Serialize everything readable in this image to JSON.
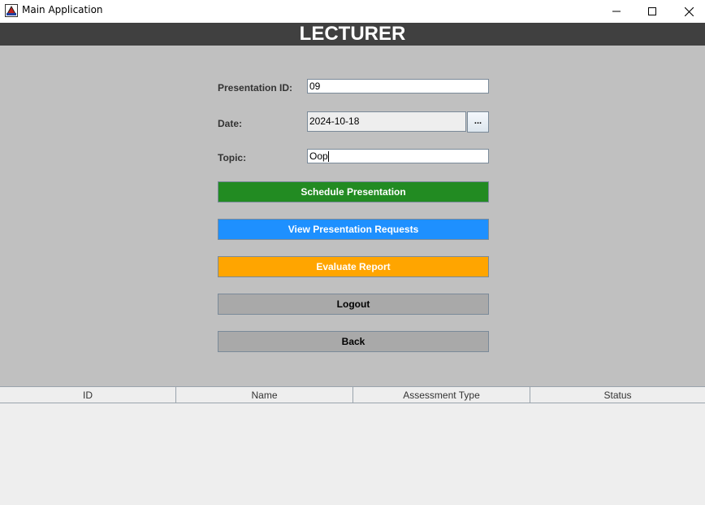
{
  "window": {
    "title": "Main Application",
    "controls": [
      "minimize-icon",
      "maximize-icon",
      "close-icon"
    ]
  },
  "header": {
    "title": "LECTURER",
    "background": "#404040"
  },
  "form": {
    "presentation_id": {
      "label": "Presentation ID:",
      "value": "09"
    },
    "date": {
      "label": "Date:",
      "value": "2024-10-18",
      "picker_label": "..."
    },
    "topic": {
      "label": "Topic:",
      "value": "Oop"
    }
  },
  "buttons": {
    "schedule": {
      "label": "Schedule Presentation",
      "color": "#228b22"
    },
    "view_requests": {
      "label": "View Presentation Requests",
      "color": "#1e90ff"
    },
    "evaluate": {
      "label": "Evaluate Report",
      "color": "#ffa500"
    },
    "logout": {
      "label": "Logout",
      "color": "#a9a9a9"
    },
    "back": {
      "label": "Back",
      "color": "#a9a9a9"
    }
  },
  "table": {
    "columns": [
      "ID",
      "Name",
      "Assessment Type",
      "Status"
    ],
    "rows": []
  }
}
